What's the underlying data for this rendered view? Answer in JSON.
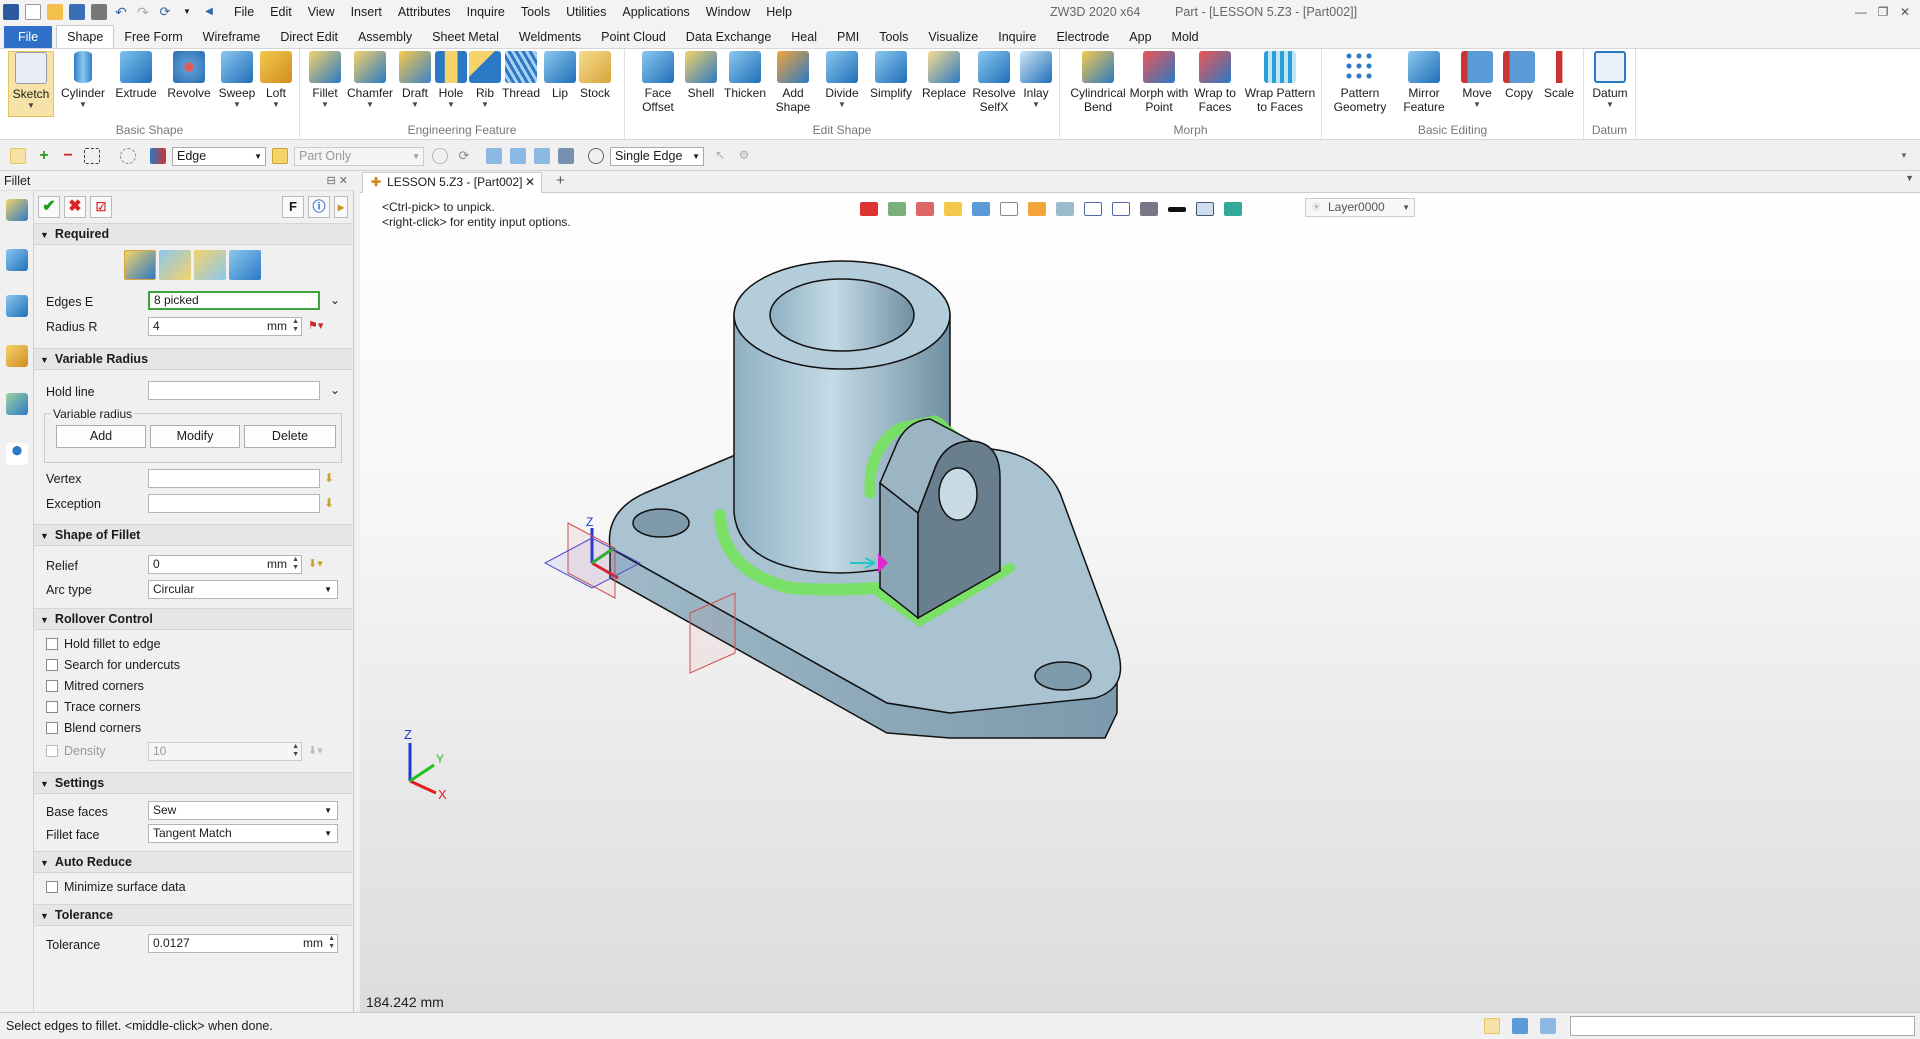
{
  "titlebar": {
    "menus": [
      "File",
      "Edit",
      "View",
      "Insert",
      "Attributes",
      "Inquire",
      "Tools",
      "Utilities",
      "Applications",
      "Window",
      "Help"
    ],
    "title": "ZW3D 2020 x64          Part - [LESSON 5.Z3 - [Part002]]",
    "controls": [
      "—",
      "❐",
      "✕"
    ]
  },
  "ribbon_tabs": {
    "file": "File",
    "tabs": [
      "Shape",
      "Free Form",
      "Wireframe",
      "Direct Edit",
      "Assembly",
      "Sheet Metal",
      "Weldments",
      "Point Cloud",
      "Data Exchange",
      "Heal",
      "PMI",
      "Tools",
      "Visualize",
      "Inquire",
      "Electrode",
      "App",
      "Mold"
    ],
    "active": "Shape"
  },
  "ribbon": {
    "groups": [
      {
        "name": "Basic Shape",
        "buttons": [
          "Sketch",
          "Cylinder",
          "Extrude",
          "Revolve",
          "Sweep",
          "Loft"
        ]
      },
      {
        "name": "Engineering Feature",
        "buttons": [
          "Fillet",
          "Chamfer",
          "Draft",
          "Hole",
          "Rib",
          "Thread",
          "Lip",
          "Stock"
        ]
      },
      {
        "name": "Edit Shape",
        "buttons": [
          "Face\nOffset",
          "Shell",
          "Thicken",
          "Add\nShape",
          "Divide",
          "Simplify",
          "Replace",
          "Resolve\nSelfX",
          "Inlay"
        ]
      },
      {
        "name": "Morph",
        "buttons": [
          "Cylindrical\nBend",
          "Morph with\nPoint",
          "Wrap to\nFaces",
          "Wrap Pattern\nto Faces"
        ]
      },
      {
        "name": "Basic Editing",
        "buttons": [
          "Pattern\nGeometry",
          "Mirror\nFeature",
          "Move",
          "Copy",
          "Scale"
        ]
      },
      {
        "name": "Datum",
        "buttons": [
          "Datum"
        ]
      }
    ]
  },
  "toolbar2": {
    "filter": "Edge",
    "scope": "Part Only",
    "pick_mode": "Single Edge"
  },
  "panel": {
    "title": "Fillet",
    "f_button": "F",
    "sections": {
      "required": "Required",
      "variable_radius": "Variable Radius",
      "shape_of_fillet": "Shape of Fillet",
      "rollover": "Rollover Control",
      "settings": "Settings",
      "auto_reduce": "Auto Reduce",
      "tolerance": "Tolerance"
    },
    "edges_label": "Edges E",
    "edges_value": "8 picked",
    "radius_label": "Radius R",
    "radius_value": "4",
    "unit": "mm",
    "hold_line_label": "Hold line",
    "variable_radius_group": "Variable radius",
    "add": "Add",
    "modify": "Modify",
    "delete": "Delete",
    "vertex_label": "Vertex",
    "exception_label": "Exception",
    "relief_label": "Relief",
    "relief_value": "0",
    "arc_type_label": "Arc type",
    "arc_type_value": "Circular",
    "rollover_options": [
      "Hold fillet to edge",
      "Search for undercuts",
      "Mitred corners",
      "Trace corners",
      "Blend corners"
    ],
    "density_label": "Density",
    "density_value": "10",
    "base_faces_label": "Base faces",
    "base_faces_value": "Sew",
    "fillet_face_label": "Fillet face",
    "fillet_face_value": "Tangent Match",
    "minimize_label": "Minimize surface data",
    "tolerance_label": "Tolerance",
    "tolerance_value": "0.0127"
  },
  "document": {
    "tab": "LESSON 5.Z3 - [Part002]",
    "hint1": "<Ctrl-pick> to unpick.",
    "hint2": "<right-click> for entity input options.",
    "layer": "Layer0000",
    "scale": "184.242 mm",
    "axes": {
      "x": "X",
      "y": "Y",
      "z": "Z"
    }
  },
  "status": {
    "message": "Select edges to fillet.  <middle-click> when done."
  }
}
